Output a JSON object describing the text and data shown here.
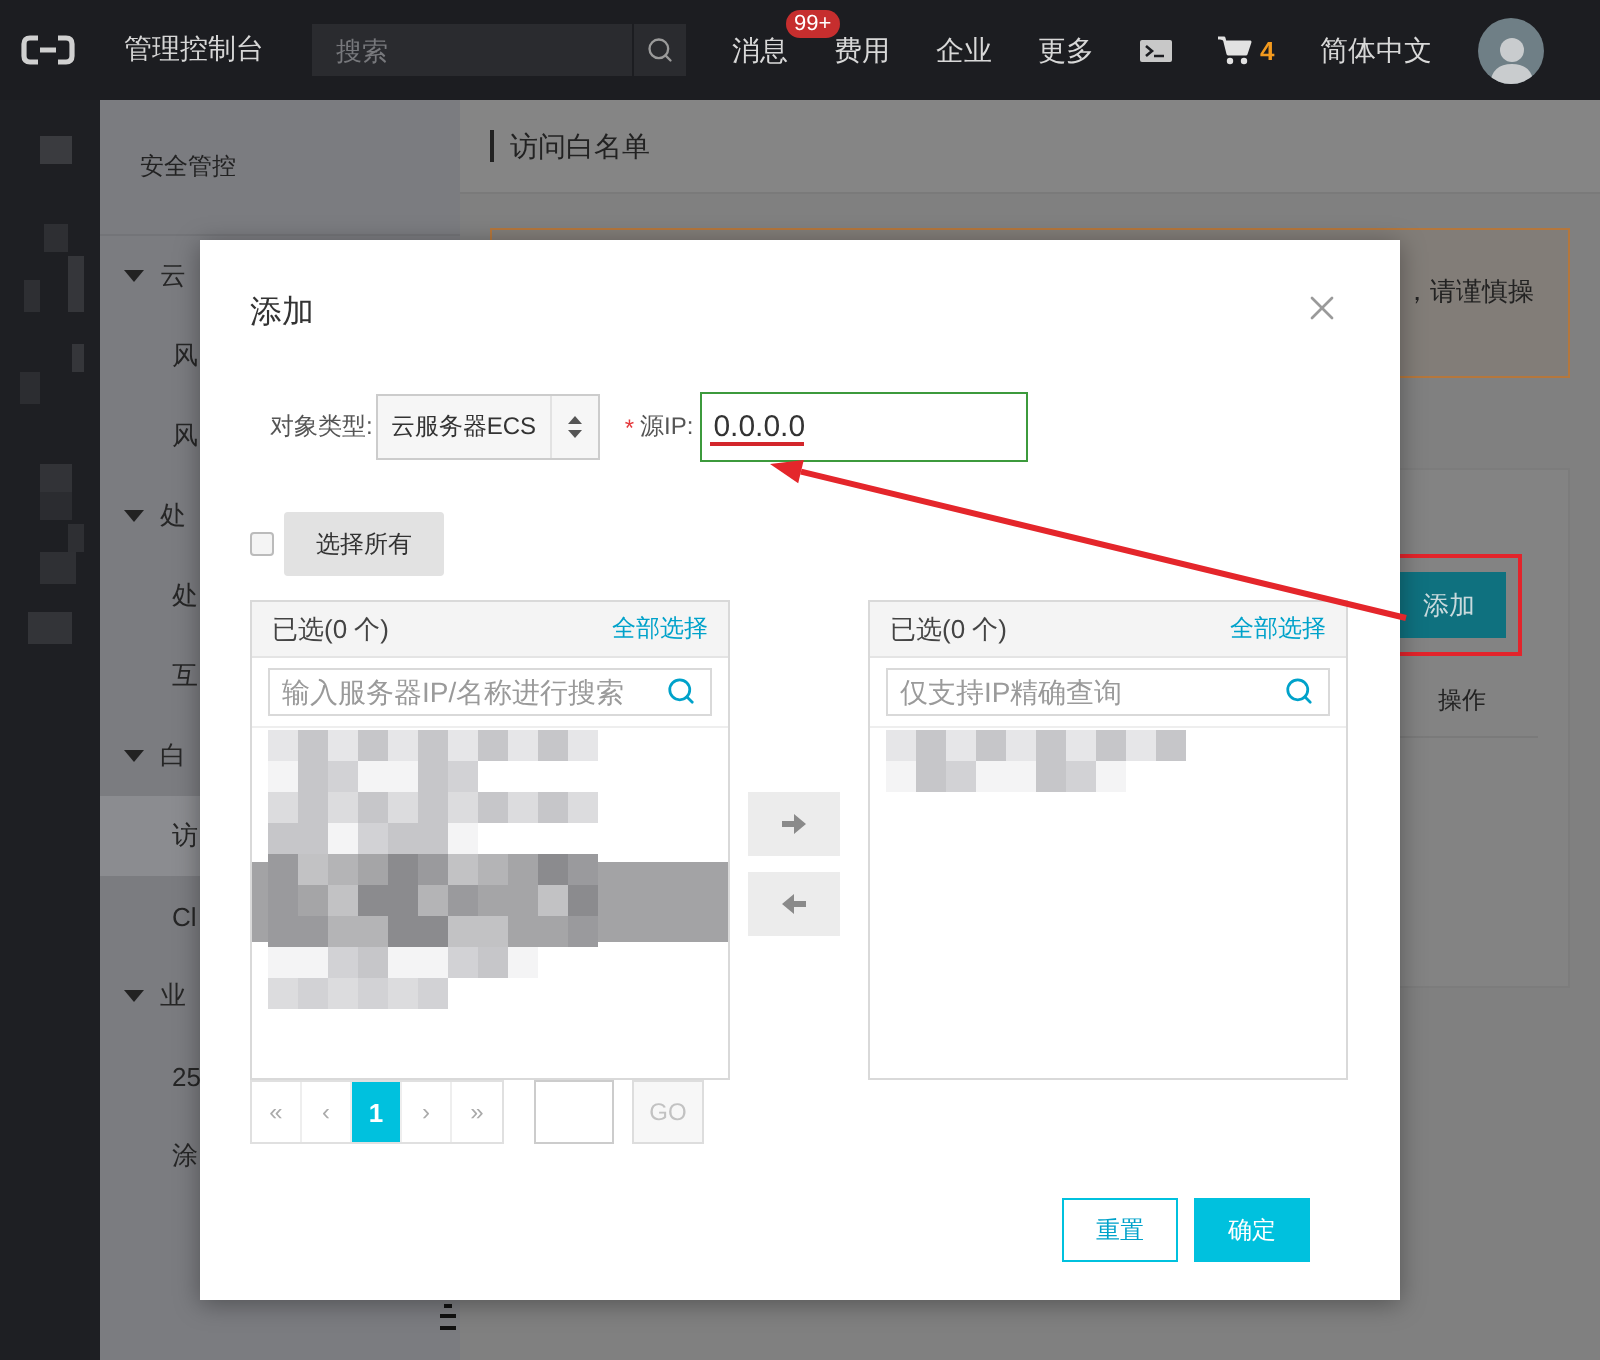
{
  "top_bar": {
    "title": "管理控制台",
    "search": {
      "placeholder": "搜索"
    },
    "links": [
      {
        "label": "消息",
        "badge": "99+"
      },
      {
        "label": "费用"
      },
      {
        "label": "企业"
      },
      {
        "label": "更多"
      }
    ],
    "cart_count": "4",
    "language": "简体中文"
  },
  "sidebar": {
    "title": "安全管控",
    "groups": [
      {
        "label": "云",
        "expanded": true,
        "children": [
          {
            "label": "风",
            "selected": false
          },
          {
            "label": "风",
            "selected": false
          }
        ]
      },
      {
        "label": "处",
        "expanded": true,
        "children": [
          {
            "label": "处",
            "selected": false
          },
          {
            "label": "互",
            "selected": false
          }
        ]
      },
      {
        "label": "白",
        "expanded": true,
        "children": [
          {
            "label": "访",
            "selected": true
          },
          {
            "label": "Cl",
            "selected": false
          }
        ]
      },
      {
        "label": "业",
        "expanded": true,
        "children": [
          {
            "label": "25",
            "selected": false
          },
          {
            "label": "涂",
            "selected": false
          }
        ]
      }
    ]
  },
  "page": {
    "title": "访问白名单",
    "notice": "，请谨慎操",
    "add_button": "添加",
    "columns": [
      "操作"
    ]
  },
  "dialog": {
    "title": "添加",
    "type_label": "对象类型:",
    "type_value": "云服务器ECS",
    "ip_required_mark": "*",
    "ip_label": "源IP:",
    "ip_value": "0.0.0.0",
    "select_all": {
      "label": "选择所有",
      "checked": false
    },
    "lists": [
      {
        "title": "已选(0 个)",
        "link": "全部选择",
        "placeholder": "输入服务器IP/名称进行搜索"
      },
      {
        "title": "已选(0 个)",
        "link": "全部选择",
        "placeholder": "仅支持IP精确查询"
      }
    ],
    "pagination": [
      {
        "label": "«",
        "selected": false
      },
      {
        "label": "‹",
        "selected": false
      },
      {
        "label": "1",
        "selected": true
      },
      {
        "label": "›",
        "selected": false
      },
      {
        "label": "»",
        "selected": false
      }
    ],
    "go_button": "GO",
    "buttons": [
      {
        "label": "重置",
        "kind": "secondary"
      },
      {
        "label": "确定",
        "kind": "primary"
      }
    ]
  }
}
